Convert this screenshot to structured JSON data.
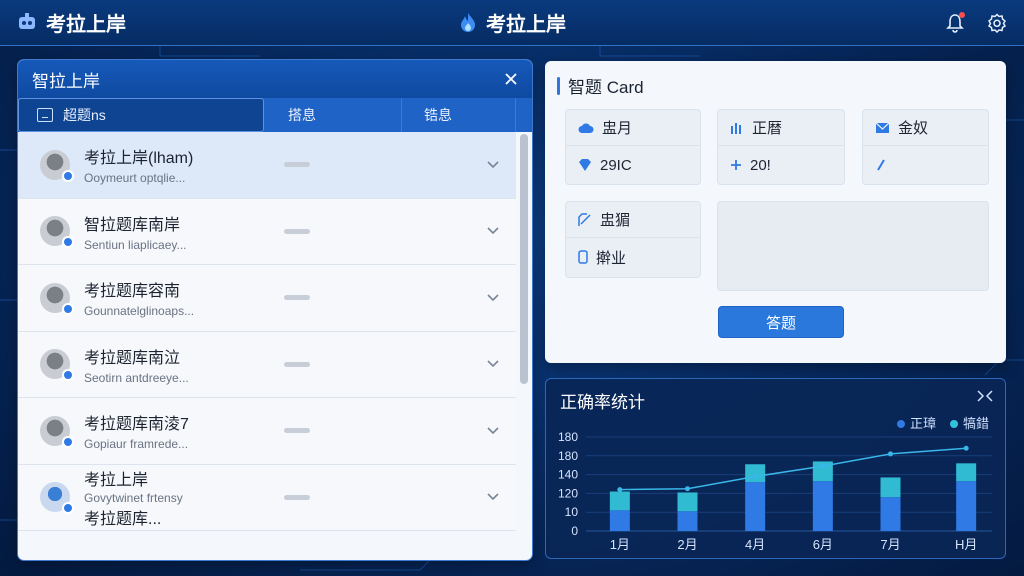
{
  "topbar": {
    "left_title": "考拉上岸",
    "center_title": "考拉上岸"
  },
  "left_panel": {
    "title": "智拉上岸",
    "tabs": [
      {
        "label": "超题ns",
        "icon": "box-icon"
      },
      {
        "label": "搭息"
      },
      {
        "label": "锆息"
      }
    ],
    "rows": [
      {
        "title": "考拉上岸(lham)",
        "subtitle": "Ooymeurt optqlie..."
      },
      {
        "title": "智拉题库南岸",
        "subtitle": "Sentiun liaplicaey..."
      },
      {
        "title": "考拉题库容南",
        "subtitle": "Gounnatelglinoaps..."
      },
      {
        "title": "考拉题库南泣",
        "subtitle": "Seotirn antdreeye..."
      },
      {
        "title": "考拉题库南淩7",
        "subtitle": "Gopiaur framrede..."
      },
      {
        "title": "考拉上岸",
        "subtitle": "Govytwinet frtensy",
        "title2": "考拉题库..."
      }
    ]
  },
  "card_panel": {
    "title": "智题 Card",
    "tiles": [
      {
        "head": "盅月",
        "head_icon": "cloud-icon",
        "value": "29IC",
        "value_icon": "diamond-icon"
      },
      {
        "head": "正暦",
        "head_icon": "bars-icon",
        "value": "20!",
        "value_icon": "plus-icon"
      },
      {
        "head": "金奴",
        "head_icon": "mail-icon",
        "value": "",
        "value_icon": "pen-icon"
      },
      {
        "head": "盅猸",
        "head_icon": "edit-icon",
        "value": "擀业",
        "value_icon": "phone-icon"
      }
    ],
    "button_label": "答题"
  },
  "chart_panel": {
    "title": "正确率统计",
    "legend": [
      {
        "label": "正璋",
        "color": "#2f7ae5"
      },
      {
        "label": "犒錯",
        "color": "#33c3d9"
      }
    ]
  },
  "chart_data": {
    "type": "bar",
    "categories": [
      "1月",
      "2月",
      "4月",
      "6月",
      "7月",
      "H月"
    ],
    "y_tick_labels": [
      "0",
      "10",
      "120",
      "140",
      "180",
      "180"
    ],
    "series": [
      {
        "name": "正璋",
        "values": [
          22,
          21,
          52,
          53,
          36,
          53
        ]
      },
      {
        "name": "犒錯",
        "values": [
          20,
          20,
          19,
          21,
          21,
          19
        ]
      }
    ],
    "line": [
      44,
      45,
      58,
      69,
      82,
      88
    ],
    "ylim": [
      0,
      100
    ],
    "colors": {
      "bottom": "#2f7ae5",
      "top": "#33c3d9",
      "line": "#3ab6e8"
    }
  }
}
